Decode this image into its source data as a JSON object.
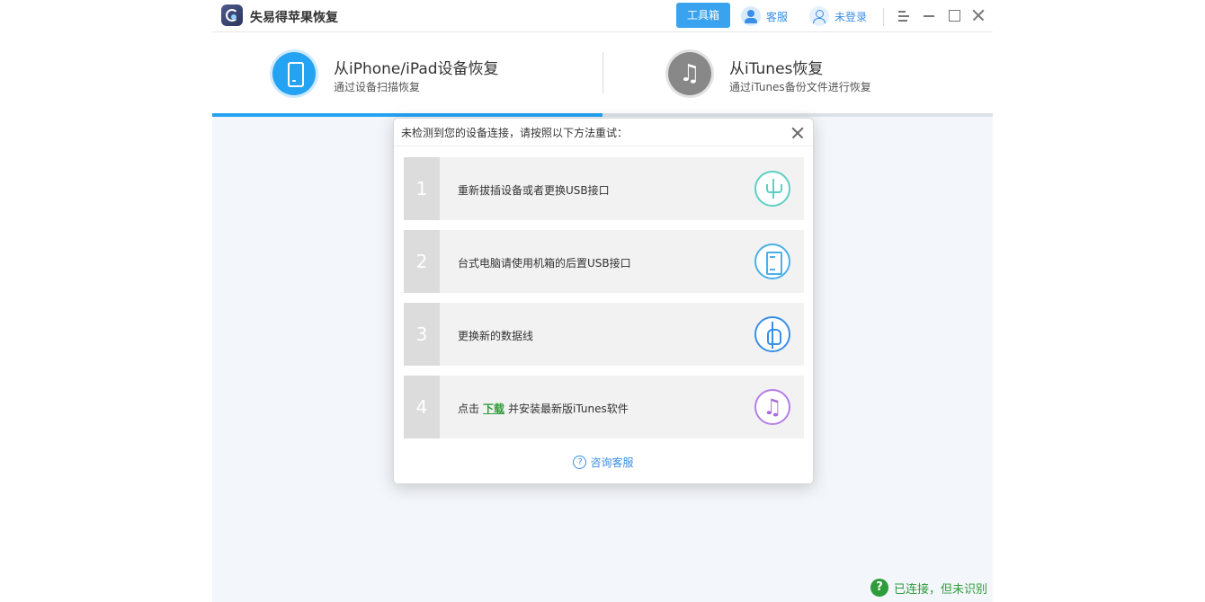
{
  "app": {
    "title": "失易得苹果恢复"
  },
  "titlebar": {
    "toolbox_label": "工具箱",
    "service_label": "客服",
    "login_label": "未登录"
  },
  "modes": {
    "device": {
      "title": "从iPhone/iPad设备恢复",
      "subtitle": "通过设备扫描恢复",
      "icon": "phone-icon",
      "active": true
    },
    "itunes": {
      "title": "从iTunes恢复",
      "subtitle": "通过iTunes备份文件进行恢复",
      "icon": "music-note-icon",
      "glyph": "♫",
      "active": false
    }
  },
  "dialog": {
    "title": "未检测到您的设备连接，请按照以下方法重试：",
    "steps": [
      {
        "num": "1",
        "text": "重新拔插设备或者更换USB接口",
        "icon": "usb-icon"
      },
      {
        "num": "2",
        "text": "台式电脑请使用机箱的后置USB接口",
        "icon": "desktop-tower-icon"
      },
      {
        "num": "3",
        "text": "更换新的数据线",
        "icon": "cable-icon"
      },
      {
        "num": "4",
        "text_before": "点击",
        "link": "下载",
        "text_after": "并安装最新版iTunes软件",
        "icon": "itunes-icon",
        "glyph": "♫"
      }
    ],
    "consult_label": "咨询客服",
    "consult_glyph": "?"
  },
  "status": {
    "glyph": "?",
    "text": "已连接，但未识别"
  },
  "colors": {
    "accent": "#25a3f3",
    "link_green": "#2e9c3b",
    "link_blue": "#3a8ee6"
  }
}
